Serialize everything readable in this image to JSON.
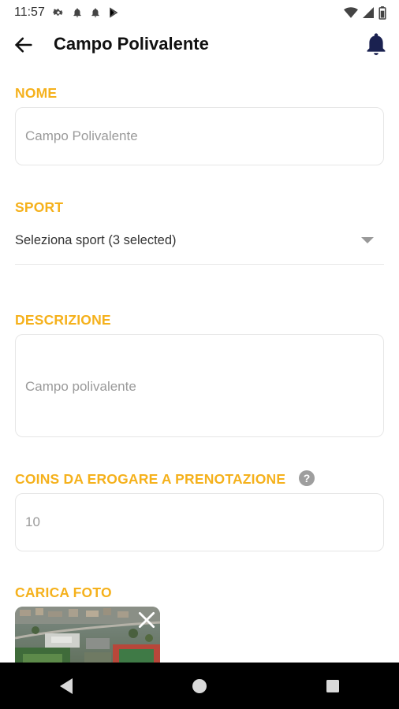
{
  "status_bar": {
    "time": "11:57"
  },
  "header": {
    "title": "Campo Polivalente"
  },
  "form": {
    "name": {
      "label": "NOME",
      "placeholder": "Campo Polivalente"
    },
    "sport": {
      "label": "SPORT",
      "value": "Seleziona sport (3 selected)"
    },
    "description": {
      "label": "DESCRIZIONE",
      "placeholder": "Campo polivalente"
    },
    "coins": {
      "label": "COINS DA EROGARE A PRENOTAZIONE",
      "placeholder": "10"
    },
    "photo": {
      "label": "CARICA FOTO"
    }
  },
  "colors": {
    "accent": "#f5b11c",
    "bell": "#1a2150",
    "navbar": "#000000"
  }
}
